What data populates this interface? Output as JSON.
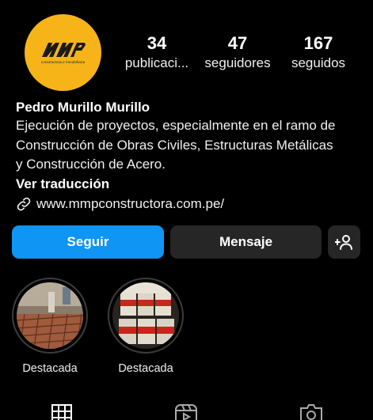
{
  "profile": {
    "avatar_logo_text": "MMP",
    "avatar_logo_subtext": "constructora e inmobiliaria"
  },
  "stats": [
    {
      "value": "34",
      "label": "publicaci..."
    },
    {
      "value": "47",
      "label": "seguidores"
    },
    {
      "value": "167",
      "label": "seguidos"
    }
  ],
  "bio": {
    "name": "Pedro Murillo Murillo",
    "lines": [
      "Ejecución de proyectos, especialmente en el ramo de",
      "Construcción de Obras Civiles, Estructuras Metálicas",
      "y Construcción de Acero."
    ],
    "translate_label": "Ver traducción",
    "link_icon": "link-icon",
    "website": "www.mmpconstructora.com.pe/"
  },
  "actions": {
    "follow_label": "Seguir",
    "message_label": "Mensaje",
    "add_user_icon": "add-user-icon"
  },
  "highlights": [
    {
      "label": "Destacada"
    },
    {
      "label": "Destacada"
    }
  ],
  "tabs": [
    {
      "icon": "grid-icon"
    },
    {
      "icon": "reels-icon"
    },
    {
      "icon": "tagged-icon"
    }
  ],
  "colors": {
    "background": "#000000",
    "accent_button": "#0f95f4",
    "secondary_button": "#262626",
    "avatar_bg": "#f6b419"
  }
}
